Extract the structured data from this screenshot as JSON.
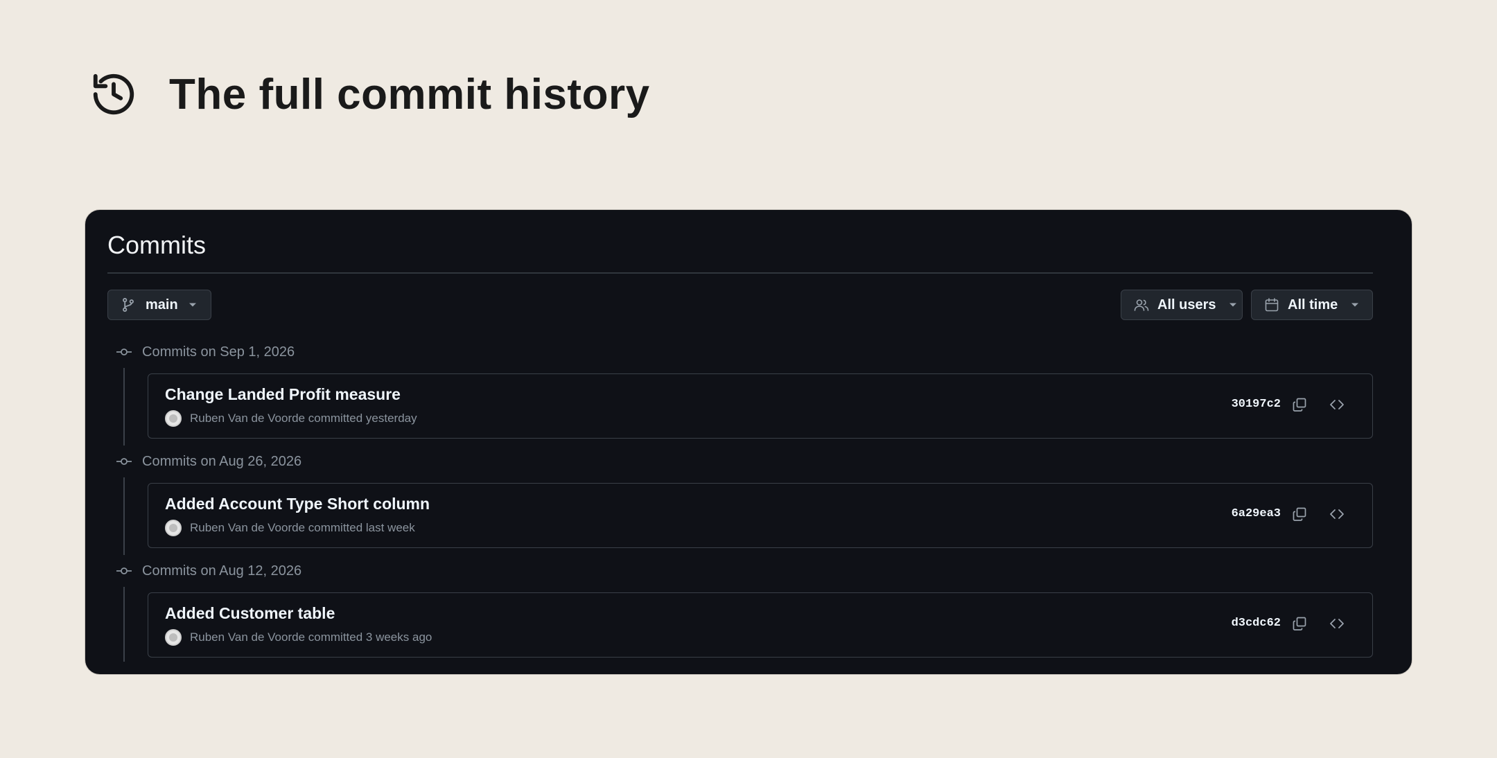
{
  "page": {
    "title": "The full commit history",
    "icon": "history-icon"
  },
  "panel": {
    "title": "Commits"
  },
  "toolbar": {
    "branch": {
      "label": "main",
      "icon": "git-branch-icon"
    },
    "users": {
      "label": "All users",
      "icon": "people-icon"
    },
    "time": {
      "label": "All time",
      "icon": "calendar-icon"
    }
  },
  "groups": [
    {
      "date_label": "Commits on Sep 1, 2026",
      "commits": [
        {
          "title": "Change Landed Profit measure",
          "meta": "Ruben Van de Voorde committed yesterday",
          "sha": "30197c2"
        }
      ]
    },
    {
      "date_label": "Commits on Aug 26, 2026",
      "commits": [
        {
          "title": "Added Account Type Short column",
          "meta": "Ruben Van de Voorde committed last week",
          "sha": "6a29ea3"
        }
      ]
    },
    {
      "date_label": "Commits on Aug 12, 2026",
      "commits": [
        {
          "title": "Added Customer table",
          "meta": "Ruben Van de Voorde committed 3 weeks ago",
          "sha": "d3cdc62"
        }
      ]
    }
  ],
  "colors": {
    "background": "#efeae2",
    "panel": "#0f1117",
    "text_primary": "#f0f6fc",
    "text_muted": "#8b949e",
    "border": "#3a4048"
  }
}
